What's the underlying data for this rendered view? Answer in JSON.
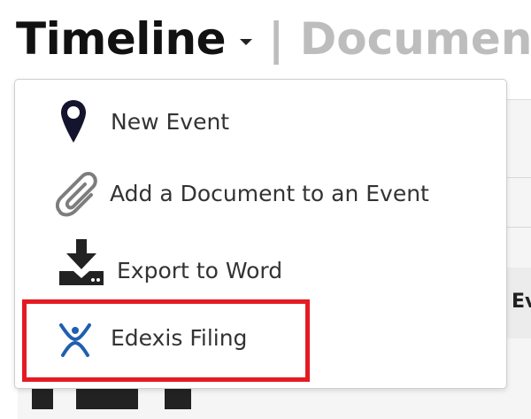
{
  "header": {
    "title": "Timeline",
    "secondary_tab": "| Documen"
  },
  "background": {
    "column_header_partial": "Ev"
  },
  "menu": {
    "items": [
      {
        "label": "New Event",
        "icon": "map-pin-icon"
      },
      {
        "label": "Add a Document to an Event",
        "icon": "paperclip-icon"
      },
      {
        "label": "Export to Word",
        "icon": "download-icon"
      },
      {
        "label": "Edexis Filing",
        "icon": "edexis-logo-icon"
      }
    ]
  },
  "colors": {
    "highlight": "#e31b23",
    "edexis_blue": "#1f5fb0",
    "pin": "#14142e"
  }
}
